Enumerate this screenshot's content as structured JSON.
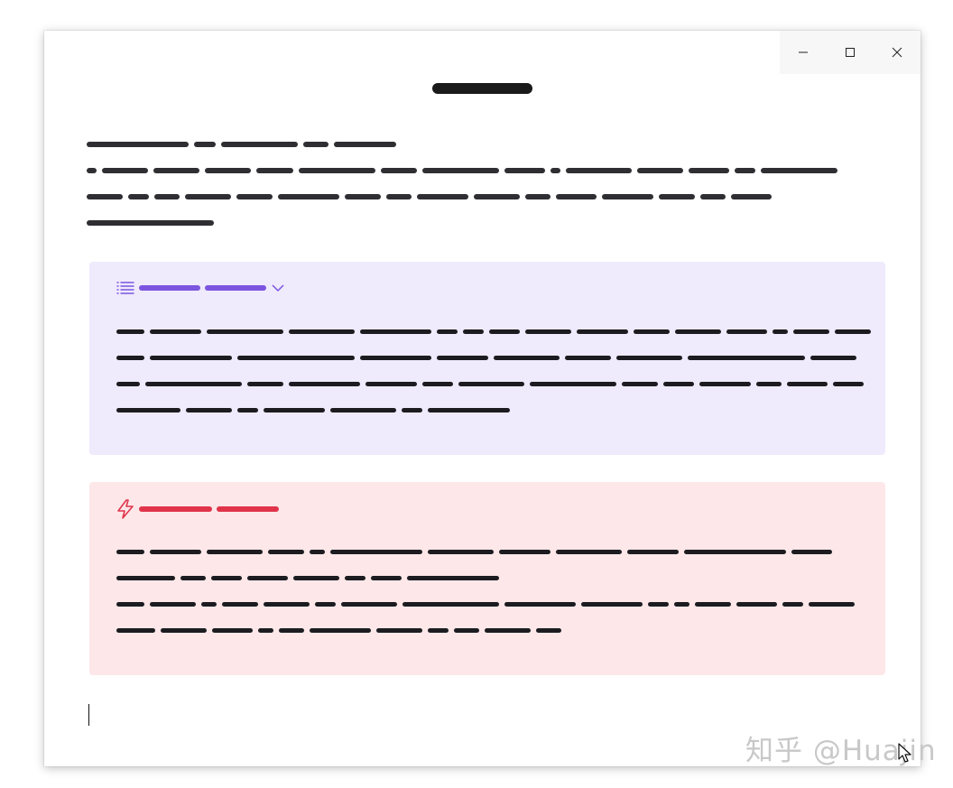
{
  "window": {
    "controls": {
      "minimize": "minimize",
      "maximize": "maximize",
      "close": "close"
    }
  },
  "callouts": [
    {
      "kind": "toc",
      "icon": "list-icon",
      "accent": "#7b55e0",
      "background": "#efeafc"
    },
    {
      "kind": "warning",
      "icon": "lightning-icon",
      "accent": "#e0344a",
      "background": "#fde7e9"
    }
  ],
  "watermark": {
    "text": "知乎 @Huajin"
  },
  "colors": {
    "text_bar": "#2f2f33",
    "title_bar": "#1a1a1a"
  }
}
